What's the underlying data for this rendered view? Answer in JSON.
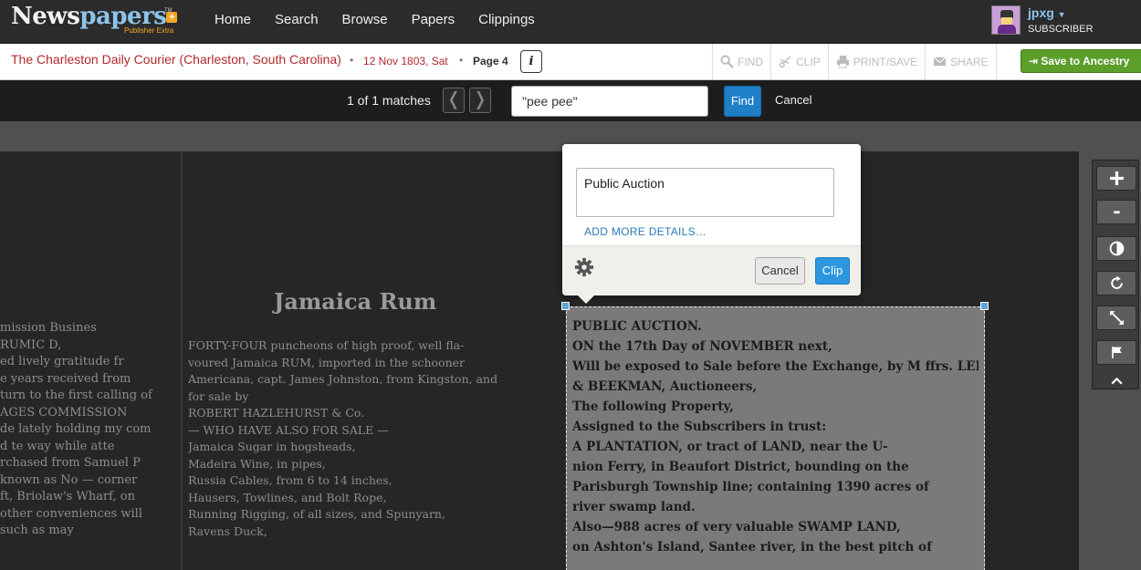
{
  "header": {
    "logo_text_a": "News",
    "logo_text_b": "papers",
    "logo_tm": "TM",
    "logo_plus": "+",
    "logo_sub": "Publisher Extra",
    "nav": [
      "Home",
      "Search",
      "Browse",
      "Papers",
      "Clippings"
    ],
    "user": {
      "name": "jpxg",
      "type": "SUBSCRIBER"
    }
  },
  "paper": {
    "title": "The Charleston Daily Courier (Charleston, South Carolina)",
    "date": "12 Nov 1803, Sat",
    "page": "Page 4",
    "info_label": "i"
  },
  "tools": {
    "find": "FIND",
    "clip": "CLIP",
    "print": "PRINT/SAVE",
    "share": "SHARE",
    "ancestry": "Save to Ancestry"
  },
  "search": {
    "matches": "1 of 1 matches",
    "prev": "❬",
    "next": "❭",
    "query": "\"pee pee\"",
    "find_label": "Find",
    "cancel_label": "Cancel"
  },
  "clip_popover": {
    "title_value": "Public Auction",
    "add_details": "ADD MORE DETAILS…",
    "cancel": "Cancel",
    "clip": "Clip"
  },
  "page_text": {
    "left_col": [
      "mission Busines",
      "RUMIC D,",
      "ed lively gratitude fr",
      "e years received from",
      "turn to the first calling of",
      "AGES COMMISSION",
      "de lately holding my com",
      "d te way while atte",
      "rchased from Samuel P",
      "known as No — corner",
      "ft, Briolaw's Wharf, on",
      "other conveniences will",
      "such as may"
    ],
    "mid_headline": "Jamaica Rum",
    "mid_col": [
      "FORTY-FOUR puncheons of high proof, well fla-",
      "voured Jamaica RUM, imported in the schooner",
      "Americana, capt. James Johnston, from Kingston, and",
      "for sale by",
      "ROBERT HAZLEHURST & Co.",
      "— WHO HAVE ALSO FOR SALE —",
      "Jamaica Sugar in hogsheads,",
      "Madeira Wine, in pipes,",
      "Russia Cables, from 6 to 14 inches,",
      "Hausers, Towlines, and Bolt Rope,",
      "Running Rigging, of all sizes, and Spunyarn,",
      "Ravens Duck,"
    ],
    "clip_col": [
      "PUBLIC AUCTION.",
      "ON the 17th Day of NOVEMBER next,",
      "Will be exposed to Sale before the Exchange, by M ffrs. LEE",
      "& BEEKMAN, Auctioneers,",
      "The following Property,",
      "Assigned to the Subscribers in trust:",
      "A PLANTATION, or tract of LAND, near the U-",
      "nion Ferry, in Beaufort District, bounding on the",
      "Parisburgh Township line; containing 1390 acres of",
      "river swamp land.",
      "Also—988 acres of very valuable SWAMP LAND,",
      "on Ashton's Island, Santee river, in the best pitch of"
    ]
  }
}
